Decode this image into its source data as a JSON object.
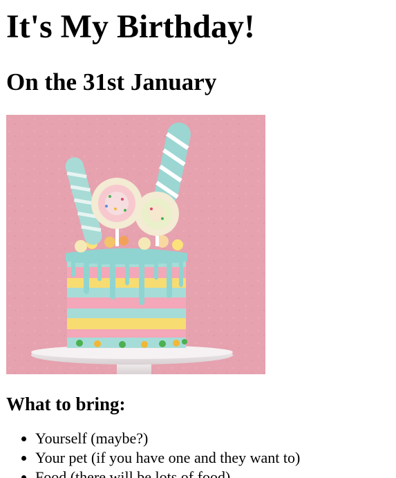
{
  "heading": {
    "title": "It's My Birthday!",
    "subtitle": "On the 31st January"
  },
  "image": {
    "subject": "layered birthday cake with lollipops and drip icing",
    "colors": {
      "background": "#e5a1ae",
      "icing_drip": "#8fd4d0",
      "stripe_pink": "#f3a7b8",
      "stripe_yellow": "#f7dc72",
      "stripe_blue": "#a6dcd8",
      "stand": "#efe9ea"
    }
  },
  "bring": {
    "heading": "What to bring:",
    "items": [
      "Yourself (maybe?)",
      "Your pet (if you have one and they want to)",
      "Food (there will be lots of food)"
    ]
  }
}
